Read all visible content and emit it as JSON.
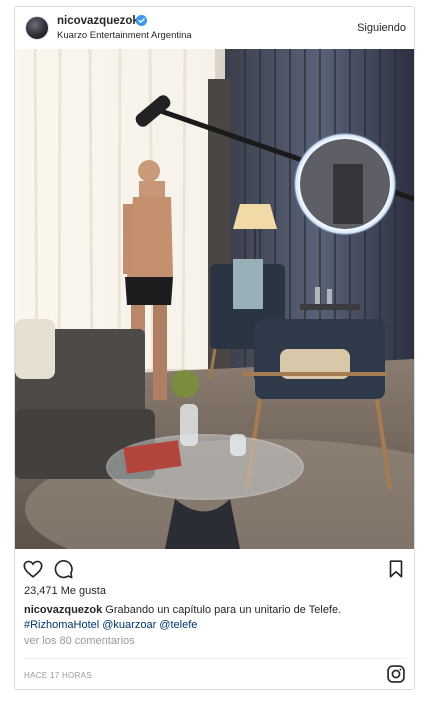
{
  "header": {
    "username": "nicovazquezok",
    "subtitle": "Kuarzo Entertainment Argentina",
    "follow_label": "Siguiendo",
    "verified_icon": "verified-badge-icon"
  },
  "post": {
    "image_description_icon": "photo",
    "likes": "23,471 Me gusta",
    "caption_user": "nicovazquezok",
    "caption_text": " Grabando un capítulo para un unitario de Telefe.",
    "caption_hashtag": "#RizhomaHotel",
    "caption_mention_1": "@kuarzoar",
    "caption_mention_2": "@telefe",
    "view_comments": "ver los 80 comentarios",
    "timestamp": "HACE 17 HORAS"
  },
  "colors": {
    "text": "#262626",
    "muted": "#999999",
    "link": "#003569",
    "verified": "#3897f0",
    "border": "#dbdbdb"
  },
  "icons": [
    "heart-icon",
    "comment-icon",
    "bookmark-icon",
    "instagram-icon",
    "verified-badge-icon"
  ]
}
